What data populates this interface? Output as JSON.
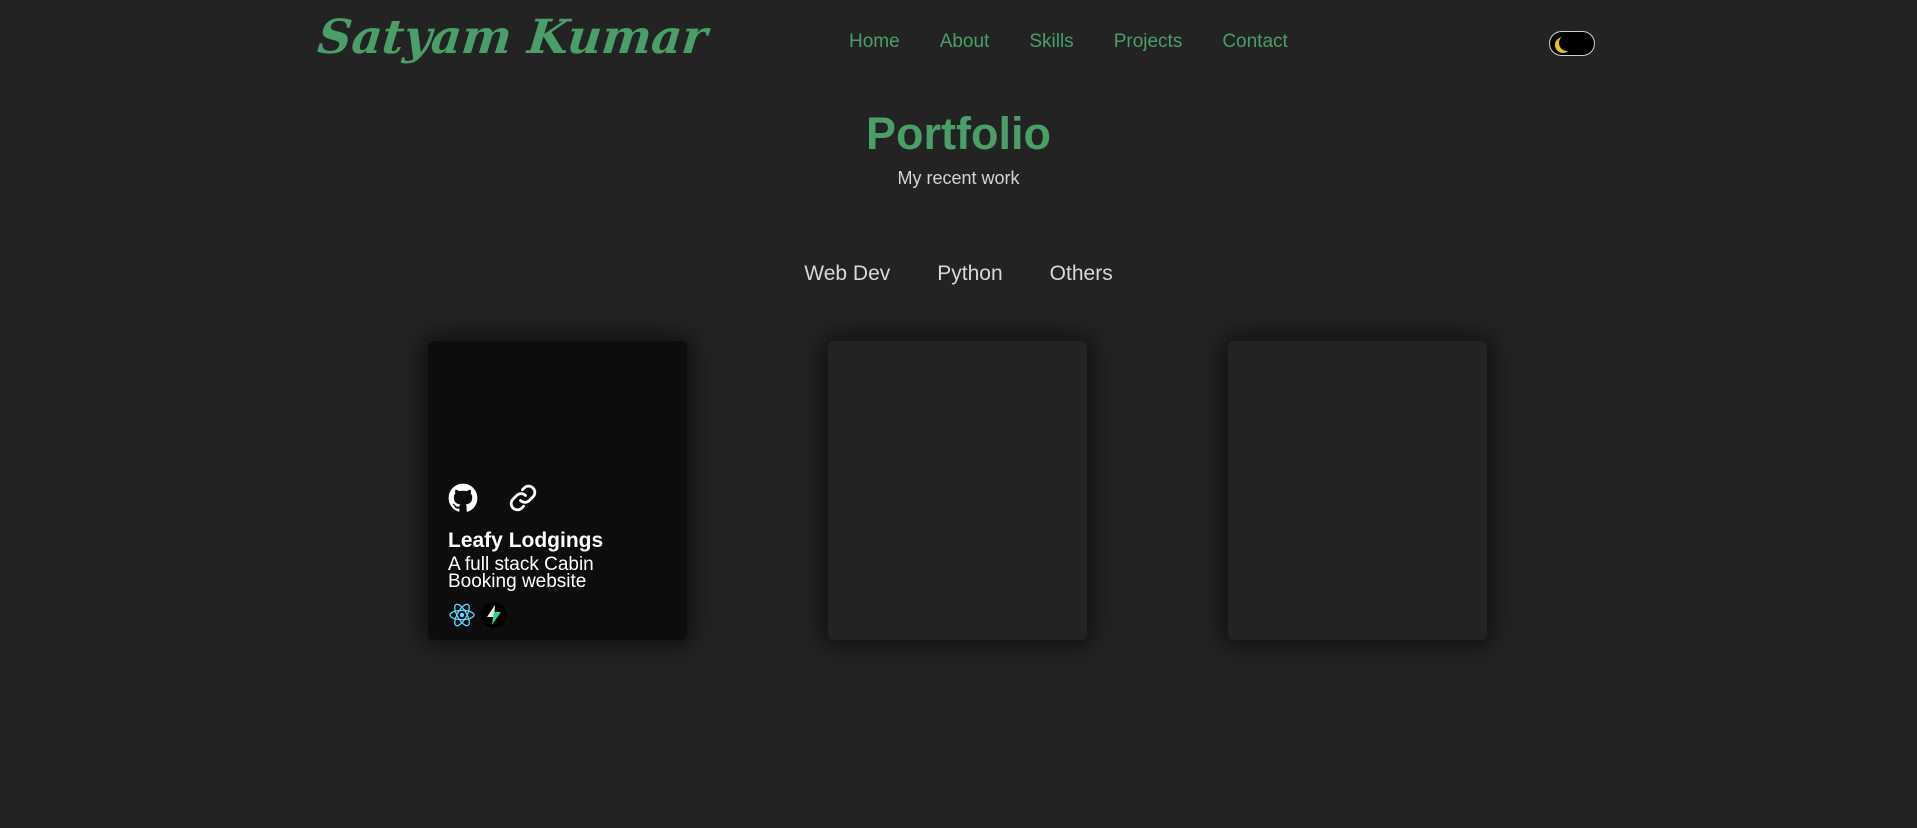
{
  "header": {
    "logo_text": "Satyam Kumar",
    "nav": [
      {
        "label": "Home"
      },
      {
        "label": "About"
      },
      {
        "label": "Skills"
      },
      {
        "label": "Projects"
      },
      {
        "label": "Contact"
      }
    ],
    "theme_toggle_icon": "moon-icon"
  },
  "portfolio": {
    "title": "Portfolio",
    "subtitle": "My recent work",
    "filters": [
      "Web Dev",
      "Python",
      "Others"
    ]
  },
  "projects": [
    {
      "title": "Leafy Lodgings",
      "description": "A full stack Cabin Booking website",
      "icons": [
        "github-icon",
        "link-icon"
      ],
      "tech": [
        "react-icon",
        "supabase-icon"
      ]
    }
  ],
  "colors": {
    "background": "#232323",
    "accent": "#4a9e68",
    "card_featured": "#0d0d0d",
    "moon": "#e6c51a"
  }
}
